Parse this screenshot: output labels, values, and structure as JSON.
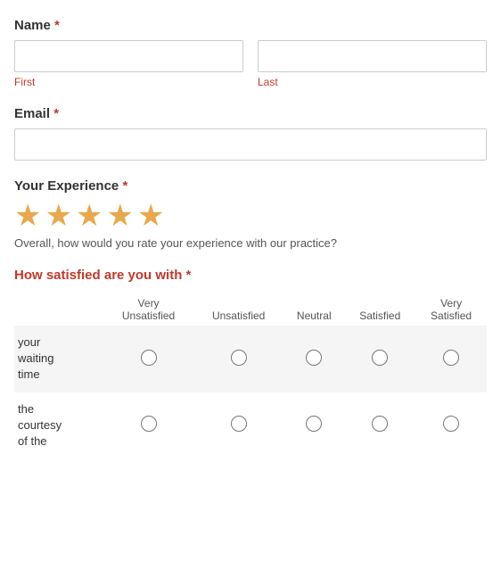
{
  "form": {
    "name_label": "Name",
    "required_marker": "*",
    "first_label": "First",
    "last_label": "Last",
    "email_label": "Email",
    "experience_label": "Your Experience",
    "experience_note": "Overall, how would you rate your experience with our practice?",
    "stars": [
      {
        "filled": true
      },
      {
        "filled": true
      },
      {
        "filled": true
      },
      {
        "filled": true
      },
      {
        "filled": true
      }
    ],
    "satisfaction_label": "How satisfied are you with",
    "satisfaction_columns": [
      {
        "line1": "Very",
        "line2": "Unsatisfied"
      },
      {
        "line1": "",
        "line2": "Unsatisfied"
      },
      {
        "line1": "",
        "line2": "Neutral"
      },
      {
        "line1": "",
        "line2": "Satisfied"
      },
      {
        "line1": "Very",
        "line2": "Satisfied"
      }
    ],
    "satisfaction_rows": [
      {
        "label": "your waiting time"
      },
      {
        "label": "the courtesy of the"
      }
    ]
  }
}
